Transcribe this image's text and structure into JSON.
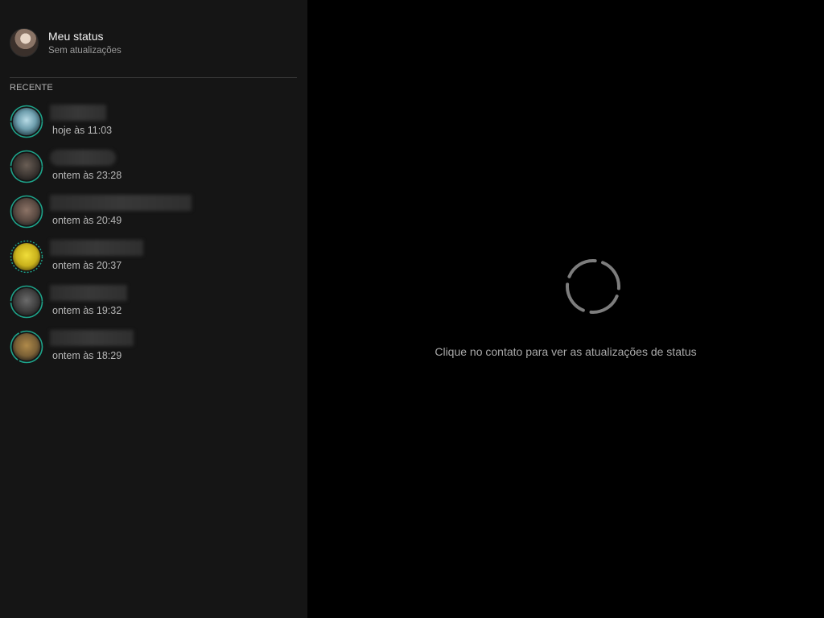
{
  "my_status": {
    "title": "Meu status",
    "subtitle": "Sem atualizações"
  },
  "section_label": "RECENTE",
  "contacts": [
    {
      "time": "hoje às 11:03"
    },
    {
      "time": "ontem às 23:28"
    },
    {
      "time": "ontem às 20:49"
    },
    {
      "time": "ontem às 20:37"
    },
    {
      "time": "ontem às 19:32"
    },
    {
      "time": "ontem às 18:29"
    }
  ],
  "main": {
    "empty_message": "Clique no contato para ver as atualizações de status"
  },
  "colors": {
    "ring_unseen": "#1ea38a",
    "ring_seen": "#4a4a4a",
    "sidebar_bg": "#151515",
    "main_bg": "#000000"
  }
}
